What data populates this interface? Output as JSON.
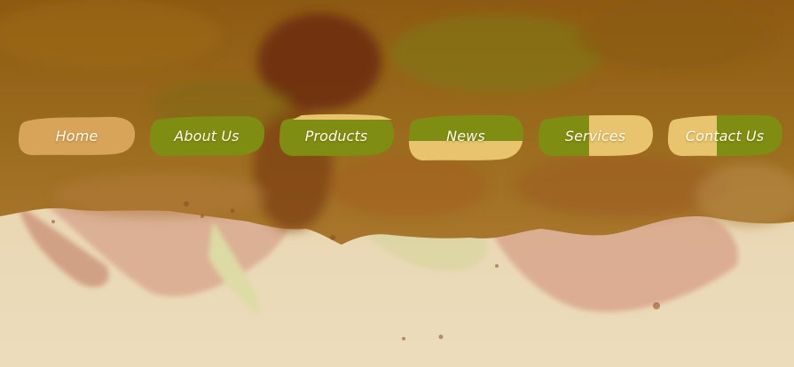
{
  "nav": {
    "items": [
      {
        "label": "Home",
        "state": "active"
      },
      {
        "label": "About Us",
        "state": "normal"
      },
      {
        "label": "Products",
        "state": "hover-top"
      },
      {
        "label": "News",
        "state": "hover-bottom"
      },
      {
        "label": "Services",
        "state": "hover-right"
      },
      {
        "label": "Contact Us",
        "state": "hover-left"
      }
    ]
  },
  "colors": {
    "blob_green": "#7f8e12",
    "blob_tan": "#d8a45a",
    "blob_yellow": "#e8c46e",
    "label_text": "#fffbe9",
    "paper": "#ead7b1"
  }
}
